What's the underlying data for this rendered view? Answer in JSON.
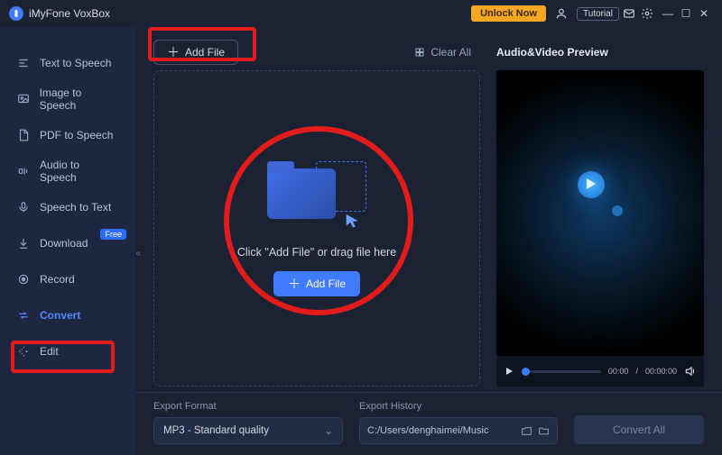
{
  "titlebar": {
    "app_name": "iMyFone VoxBox",
    "unlock_label": "Unlock Now",
    "tutorial_label": "Tutorial"
  },
  "sidebar": {
    "items": [
      {
        "label": "Text to Speech",
        "icon": "text-to-speech-icon"
      },
      {
        "label": "Image to Speech",
        "icon": "image-to-speech-icon"
      },
      {
        "label": "PDF to Speech",
        "icon": "pdf-to-speech-icon"
      },
      {
        "label": "Audio to Speech",
        "icon": "audio-to-speech-icon"
      },
      {
        "label": "Speech to Text",
        "icon": "speech-to-text-icon"
      },
      {
        "label": "Download",
        "icon": "download-icon",
        "badge": "Free"
      },
      {
        "label": "Record",
        "icon": "record-icon"
      },
      {
        "label": "Convert",
        "icon": "convert-icon",
        "active": true
      },
      {
        "label": "Edit",
        "icon": "edit-icon"
      }
    ]
  },
  "toolbar": {
    "add_file_label": "Add File",
    "clear_all_label": "Clear All"
  },
  "preview": {
    "title": "Audio&Video Preview",
    "time_current": "00:00",
    "time_total": "00:00:00"
  },
  "dropzone": {
    "hint": "Click \"Add File\" or drag file here",
    "add_label": "Add File"
  },
  "export": {
    "format_label": "Export Format",
    "format_value": "MP3 - Standard quality",
    "history_label": "Export History",
    "history_path": "C:/Users/denghaimei/Music",
    "convert_all_label": "Convert All"
  }
}
